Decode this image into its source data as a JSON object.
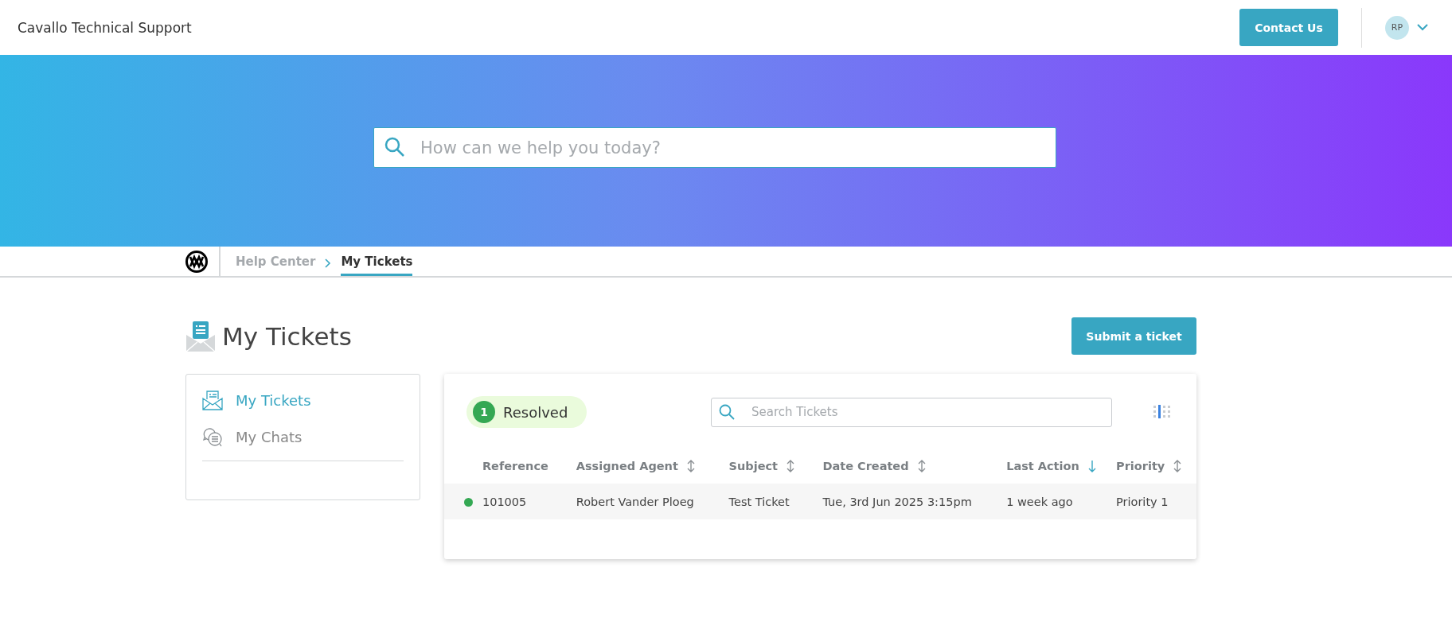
{
  "header": {
    "title": "Cavallo Technical Support",
    "contact_button": "Contact Us",
    "avatar_initials": "RP"
  },
  "hero": {
    "search": {
      "placeholder": "How can we help you today?"
    }
  },
  "breadcrumb": [
    {
      "label": "Help Center",
      "selected": false
    },
    {
      "label": "My Tickets",
      "selected": true
    }
  ],
  "page_title": "My Tickets",
  "submit_button": "Submit a ticket",
  "sidebar": {
    "items": [
      {
        "label": "My Tickets",
        "kind": "tickets",
        "selected": true
      },
      {
        "label": "My Chats",
        "kind": "chats",
        "selected": false
      }
    ]
  },
  "tickets": {
    "status_filter": {
      "count": "1",
      "label": "Resolved"
    },
    "search": {
      "placeholder": "Search Tickets"
    },
    "columns": [
      {
        "label": "Reference",
        "sortable": false,
        "sorted": false
      },
      {
        "label": "Assigned Agent",
        "sortable": true,
        "sorted": false
      },
      {
        "label": "Subject",
        "sortable": true,
        "sorted": false
      },
      {
        "label": "Date Created",
        "sortable": true,
        "sorted": false
      },
      {
        "label": "Last Action",
        "sortable": true,
        "sorted": true
      },
      {
        "label": "Priority",
        "sortable": true,
        "sorted": false
      }
    ],
    "rows": [
      {
        "color": "#34a853",
        "cells": [
          "101005",
          "Robert Vander Ploeg",
          "Test Ticket",
          "Tue, 3rd Jun 2025 3:15pm",
          "1 week ago",
          "Priority 1"
        ]
      }
    ]
  }
}
